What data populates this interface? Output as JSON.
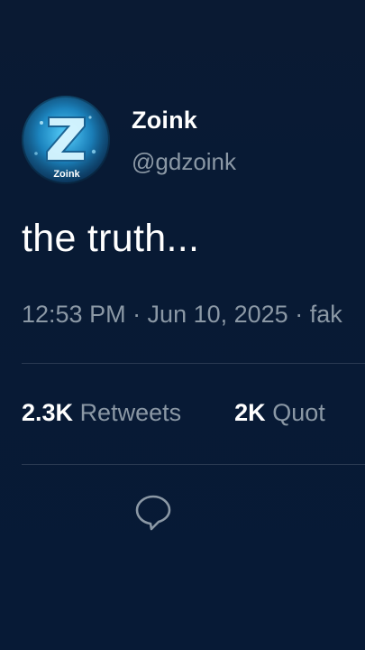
{
  "author": {
    "display_name": "Zoink",
    "handle": "@gdzoink",
    "avatar_text": "Zoink"
  },
  "tweet": {
    "text": "the truth...",
    "meta": "12:53 PM · Jun 10, 2025 · fak"
  },
  "stats": {
    "retweets_count": "2.3K",
    "retweets_label": "Retweets",
    "quotes_count": "2K",
    "quotes_label": "Quot"
  },
  "actions": {
    "reply_icon": "reply-icon"
  },
  "colors": {
    "background": "#081a34",
    "primary_text": "#ffffff",
    "secondary_text": "#8b98a5",
    "divider": "#2a3a52"
  }
}
